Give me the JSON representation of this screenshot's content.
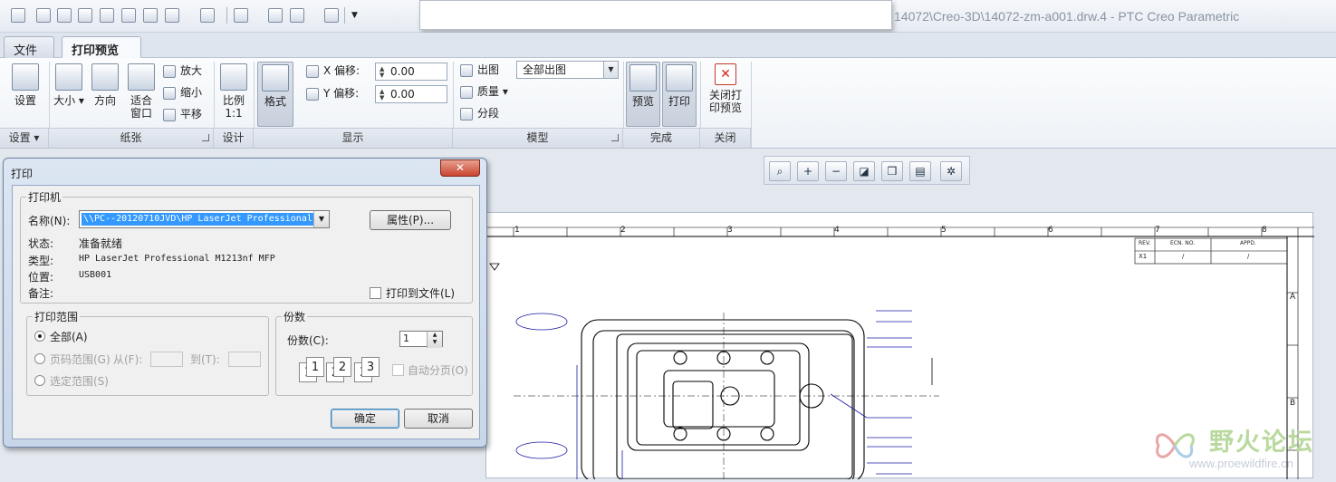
{
  "window": {
    "title": "14072\\Creo-3D\\14072-zm-a001.drw.4 - PTC Creo Parametric"
  },
  "ribbon": {
    "tabs": [
      "文件",
      "打印预览"
    ],
    "buttons": {
      "setup": "设置",
      "size": "大小",
      "orientation": "方向",
      "fit_window_1": "适合",
      "fit_window_2": "窗口",
      "zoom_in": "放大",
      "zoom_out": "缩小",
      "pan": "平移",
      "scale_1": "比例",
      "scale_2": "1:1",
      "format": "格式",
      "x_offset_label": "X  偏移:",
      "y_offset_label": "Y  偏移:",
      "x_offset_value": "0.00",
      "y_offset_value": "0.00",
      "output": "出图",
      "output_mode": "全部出图",
      "quality": "质量",
      "segment": "分段",
      "preview": "预览",
      "print": "打印",
      "close_preview_1": "关闭打",
      "close_preview_2": "印预览"
    },
    "groups": [
      "设置",
      "纸张",
      "设计",
      "显示",
      "模型",
      "完成",
      "关闭"
    ]
  },
  "drawing": {
    "border_numbers": [
      "1",
      "2",
      "3",
      "4",
      "5",
      "6",
      "7",
      "8"
    ],
    "row_letters": [
      "A",
      "B"
    ],
    "rev_headers": [
      "REV.",
      "ECN. NO.",
      "APPD."
    ],
    "rev_row": [
      "X1",
      "/",
      "/"
    ]
  },
  "watermark": {
    "text": "野火论坛",
    "url": "www.proewildfire.cn"
  },
  "dialog": {
    "title": "打印",
    "close_label": "✕",
    "printer_group": "打印机",
    "name_label": "名称(N):",
    "printer_name": "\\\\PC--20120710JVD\\HP LaserJet Professional",
    "properties_button": "属性(P)...",
    "status_label": "状态:",
    "status_value": "准备就绪",
    "type_label": "类型:",
    "type_value": "HP LaserJet Professional M1213nf MFP",
    "location_label": "位置:",
    "location_value": "USB001",
    "comment_label": "备注:",
    "print_to_file": "打印到文件(L)",
    "range_group": "打印范围",
    "range_all": "全部(A)",
    "range_pages": "页码范围(G)",
    "from_label": "从(F):",
    "to_label": "到(T):",
    "range_selection": "选定范围(S)",
    "copies_group": "份数",
    "copies_label": "份数(C):",
    "copies_value": "1",
    "collate": "自动分页(O)",
    "ok_button": "确定",
    "cancel_button": "取消"
  }
}
